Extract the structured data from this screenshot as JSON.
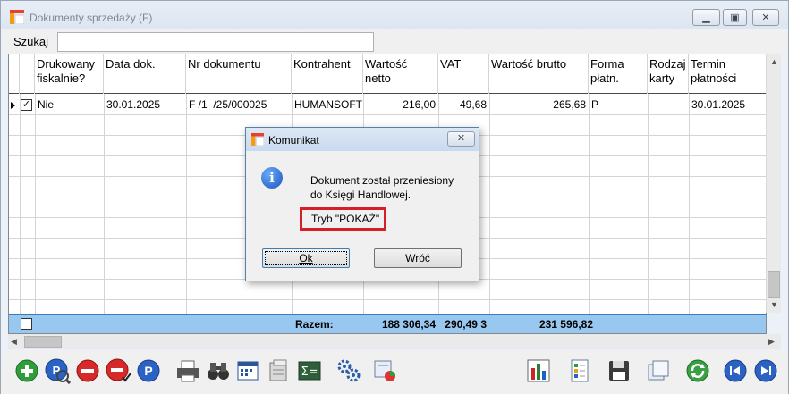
{
  "window": {
    "title": "Dokumenty sprzedaży (F)"
  },
  "search": {
    "label": "Szukaj",
    "value": ""
  },
  "grid": {
    "columns": [
      {
        "label": "",
        "key": "ind"
      },
      {
        "label": "Drukowany fiskalnie?",
        "key": "printed"
      },
      {
        "label": "Data dok.",
        "key": "date"
      },
      {
        "label": "Nr dokumentu",
        "key": "number"
      },
      {
        "label": "Kontrahent",
        "key": "contractor"
      },
      {
        "label": "Wartość netto",
        "key": "net"
      },
      {
        "label": "VAT",
        "key": "vat"
      },
      {
        "label": "Wartość brutto",
        "key": "gross"
      },
      {
        "label": "Forma płatn.",
        "key": "payment"
      },
      {
        "label": "Rodzaj karty",
        "key": "card"
      },
      {
        "label": "Termin płatności",
        "key": "due"
      }
    ],
    "rows": [
      {
        "checked": true,
        "printed": "Nie",
        "date": "30.01.2025",
        "number": "F /1  /25/000025",
        "contractor": "HUMANSOFT",
        "net": "216,00",
        "vat": "49,68",
        "gross": "265,68",
        "payment": "P",
        "card": "",
        "due": "30.01.2025"
      }
    ],
    "totals": {
      "label": "Razem:",
      "net": "188 306,34",
      "vat": "3 290,49",
      "gross": "231 596,82"
    }
  },
  "toolbar": {
    "buttons": [
      "add-icon",
      "view-icon",
      "delete-icon",
      "cancel-document-icon",
      "parking-icon",
      "print-icon",
      "binoculars-icon",
      "calendar-filter-icon",
      "archive-icon",
      "formula-icon",
      "settings-gears-icon",
      "export-icon",
      "chart-icon",
      "document-list-icon",
      "save-icon",
      "copy-icon",
      "refresh-icon",
      "prev-icon",
      "next-icon"
    ]
  },
  "dialog": {
    "title": "Komunikat",
    "message_line1": "Dokument został przeniesiony",
    "message_line2": "do Księgi Handlowej.",
    "mode": "Tryb \"POKAŻ\"",
    "ok_label": "Ok",
    "back_label": "Wróć",
    "close_glyph": "✕"
  },
  "colors": {
    "totals_bg": "#98c8ef",
    "highlight": "#d32027",
    "accent": "#3a7bc1"
  }
}
